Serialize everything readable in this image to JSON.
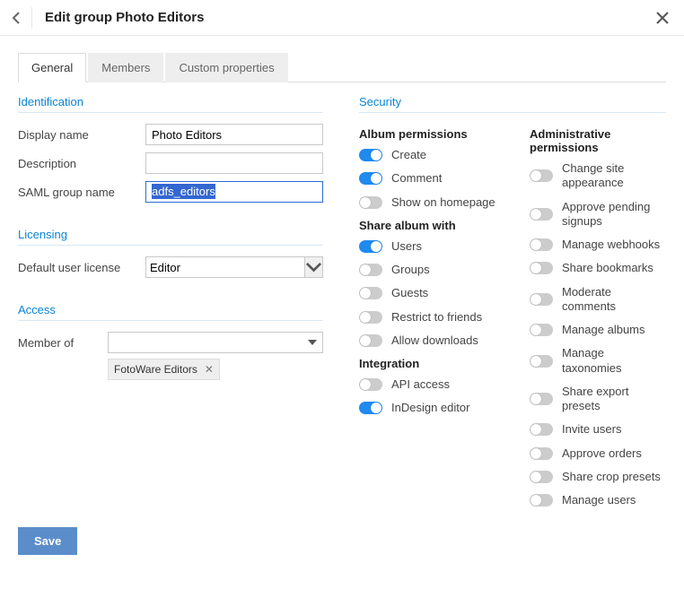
{
  "header": {
    "title": "Edit group Photo Editors"
  },
  "tabs": {
    "general": "General",
    "members": "Members",
    "custom": "Custom properties"
  },
  "identification": {
    "title": "Identification",
    "display_name_label": "Display name",
    "display_name": "Photo Editors",
    "description_label": "Description",
    "description": "",
    "saml_label": "SAML group name",
    "saml": "adfs_editors"
  },
  "licensing": {
    "title": "Licensing",
    "default_label": "Default user license",
    "default_value": "Editor"
  },
  "access": {
    "title": "Access",
    "member_of_label": "Member of",
    "tag": "FotoWare Editors"
  },
  "security": {
    "title": "Security",
    "album_perm_title": "Album permissions",
    "share_title": "Share album with",
    "integration_title": "Integration",
    "admin_title": "Administrative permissions",
    "album": {
      "create": {
        "label": "Create",
        "on": true
      },
      "comment": {
        "label": "Comment",
        "on": true
      },
      "homepage": {
        "label": "Show on homepage",
        "on": false
      }
    },
    "share": {
      "users": {
        "label": "Users",
        "on": true
      },
      "groups": {
        "label": "Groups",
        "on": false
      },
      "guests": {
        "label": "Guests",
        "on": false
      },
      "restrict": {
        "label": "Restrict to friends",
        "on": false
      },
      "downloads": {
        "label": "Allow downloads",
        "on": false
      }
    },
    "integration": {
      "api": {
        "label": "API access",
        "on": false
      },
      "indesign": {
        "label": "InDesign editor",
        "on": true
      }
    },
    "admin": {
      "appearance": {
        "label": "Change site appearance",
        "on": false
      },
      "approve_signups": {
        "label": "Approve pending signups",
        "on": false
      },
      "webhooks": {
        "label": "Manage webhooks",
        "on": false
      },
      "bookmarks": {
        "label": "Share bookmarks",
        "on": false
      },
      "moderate": {
        "label": "Moderate comments",
        "on": false
      },
      "albums": {
        "label": "Manage albums",
        "on": false
      },
      "taxonomies": {
        "label": "Manage taxonomies",
        "on": false
      },
      "export_presets": {
        "label": "Share export presets",
        "on": false
      },
      "invite": {
        "label": "Invite users",
        "on": false
      },
      "orders": {
        "label": "Approve orders",
        "on": false
      },
      "crop_presets": {
        "label": "Share crop presets",
        "on": false
      },
      "manage_users": {
        "label": "Manage users",
        "on": false
      }
    }
  },
  "footer": {
    "save": "Save"
  }
}
